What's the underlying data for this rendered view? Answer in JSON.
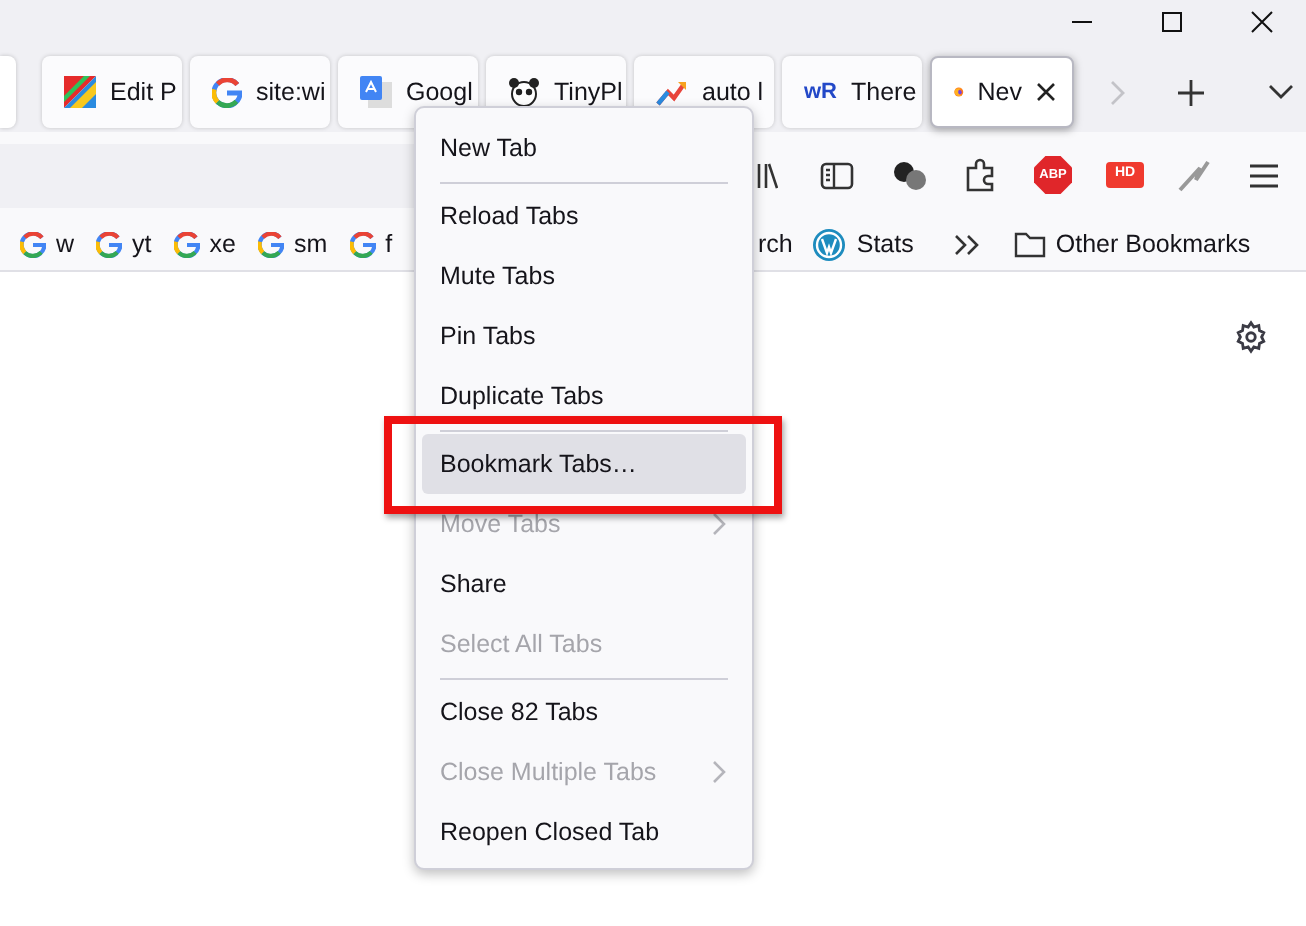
{
  "tabs": [
    {
      "label": "Edit P",
      "selected": false
    },
    {
      "label": "site:wi",
      "selected": false
    },
    {
      "label": "Googl",
      "selected": false
    },
    {
      "label": "TinyPl",
      "selected": false
    },
    {
      "label": "auto l",
      "selected": false
    },
    {
      "label": "There",
      "badge": "wR",
      "selected": false
    },
    {
      "label": "Nev",
      "selected": true
    }
  ],
  "extension_badges": [
    "ABP",
    "HD"
  ],
  "bookmarks_left": [
    {
      "label": "w"
    },
    {
      "label": "yt"
    },
    {
      "label": "xe"
    },
    {
      "label": "sm"
    },
    {
      "label": "f"
    }
  ],
  "bookmarks_right": [
    {
      "label": "rch"
    },
    {
      "label": "Stats"
    }
  ],
  "other_bookmarks": "Other Bookmarks",
  "context_menu": [
    {
      "kind": "item",
      "label": "New Tab",
      "disabled": false,
      "submenu": false,
      "highlighted": false
    },
    {
      "kind": "separator"
    },
    {
      "kind": "item",
      "label": "Reload Tabs",
      "disabled": false,
      "submenu": false,
      "highlighted": false
    },
    {
      "kind": "item",
      "label": "Mute Tabs",
      "disabled": false,
      "submenu": false,
      "highlighted": false
    },
    {
      "kind": "item",
      "label": "Pin Tabs",
      "disabled": false,
      "submenu": false,
      "highlighted": false
    },
    {
      "kind": "item",
      "label": "Duplicate Tabs",
      "disabled": false,
      "submenu": false,
      "highlighted": false
    },
    {
      "kind": "separator"
    },
    {
      "kind": "item",
      "label": "Bookmark Tabs…",
      "disabled": false,
      "submenu": false,
      "highlighted": true
    },
    {
      "kind": "item",
      "label": "Move Tabs",
      "disabled": true,
      "submenu": true,
      "highlighted": false
    },
    {
      "kind": "item",
      "label": "Share",
      "disabled": false,
      "submenu": false,
      "highlighted": false
    },
    {
      "kind": "item",
      "label": "Select All Tabs",
      "disabled": true,
      "submenu": false,
      "highlighted": false
    },
    {
      "kind": "separator"
    },
    {
      "kind": "item",
      "label": "Close 82 Tabs",
      "disabled": false,
      "submenu": false,
      "highlighted": false
    },
    {
      "kind": "item",
      "label": "Close Multiple Tabs",
      "disabled": true,
      "submenu": true,
      "highlighted": false
    },
    {
      "kind": "item",
      "label": "Reopen Closed Tab",
      "disabled": false,
      "submenu": false,
      "highlighted": false
    }
  ]
}
